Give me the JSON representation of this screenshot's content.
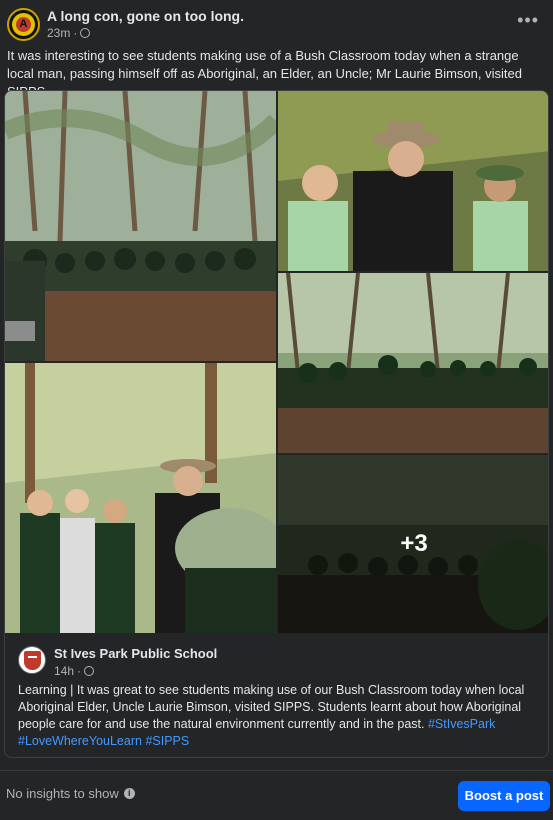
{
  "post": {
    "page_name": "A long con, gone on too long.",
    "time": "23m",
    "dot": "·",
    "more_label": "•••",
    "caption": "It was interesting to see students making use of a Bush Classroom today  when a strange local man, passing himself off as Aboriginal, an Elder, an Uncle; Mr Laurie Bimson, visited SIPPS."
  },
  "shared": {
    "page_name": "St Ives Park Public School",
    "time": "14h",
    "dot": "·",
    "text_main": "Learning | It was great to see students making use of our Bush Classroom today  when local Aboriginal Elder, Uncle Laurie Bimson, visited SIPPS.  Students learnt about how Aboriginal people care for and use the natural environment currently and in the past. ",
    "tags": [
      "#StIvesPark",
      "#LoveWhereYouLearn",
      "#SIPPS"
    ],
    "more_photos": "+3"
  },
  "footer": {
    "insights": "No insights to show",
    "info_icon": "i",
    "boost_label": "Boost a post"
  },
  "icons": {
    "globe": "globe-icon",
    "more": "more-horizontal-icon",
    "info": "info-icon"
  },
  "colors": {
    "background": "#242526",
    "text": "#e4e6eb",
    "muted": "#b0b3b8",
    "link": "#4599ff",
    "button": "#0866ff"
  }
}
